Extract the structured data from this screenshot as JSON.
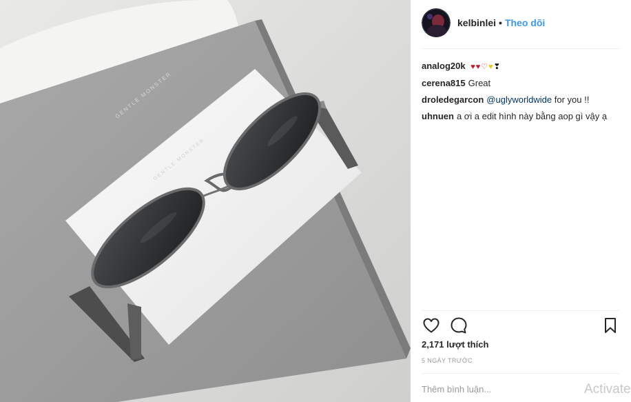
{
  "post": {
    "username": "kelbinlei",
    "separator": "•",
    "follow_label": "Theo dõi",
    "photo_brand_text": "GENTLE MONSTER"
  },
  "comments": [
    {
      "user": "analog20k",
      "text": "",
      "hearts": true
    },
    {
      "user": "cerena815",
      "text": "Great"
    },
    {
      "user": "droledegarcon",
      "mention": "@uglyworldwide",
      "text": " for you !!"
    },
    {
      "user": "uhnuen",
      "text": "a ơi a edit hình này bằng aop gì vậy ạ"
    }
  ],
  "icons": {
    "like": "heart-icon",
    "comment": "comment-bubble-icon",
    "save": "bookmark-icon"
  },
  "likes_text": "2,171 lượt thích",
  "time_text": "5 NGÀY TRƯỚC",
  "comment_placeholder": "Thêm bình luận...",
  "watermark_text": "Activate",
  "colors": {
    "accent_link": "#3897f0",
    "mention": "#003569",
    "muted": "#999999",
    "text": "#262626"
  }
}
